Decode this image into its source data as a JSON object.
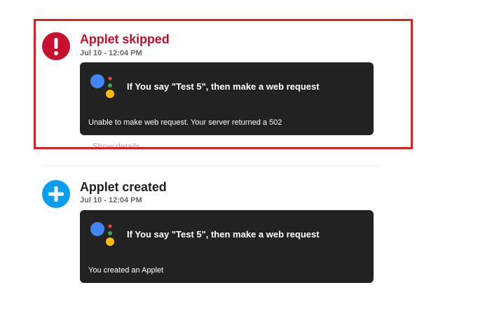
{
  "colors": {
    "skipped": "#c8102e",
    "created_icon": "#0a9df0",
    "card_bg": "#222222",
    "highlight": "#e0201e"
  },
  "events": [
    {
      "status": "skipped",
      "icon": "exclamation-icon",
      "title": "Applet skipped",
      "time": "Jul 10 - 12:04 PM",
      "applet_service_icon": "google-assistant-icon",
      "applet_title": "If You say \"Test 5\", then make a web request",
      "message": "Unable to make web request. Your server returned a 502",
      "details_link": "Show details"
    },
    {
      "status": "created",
      "icon": "plus-icon",
      "title": "Applet created",
      "time": "Jul 10 - 12:04 PM",
      "applet_service_icon": "google-assistant-icon",
      "applet_title": "If You say \"Test 5\", then make a web request",
      "message": "You created an Applet"
    }
  ]
}
